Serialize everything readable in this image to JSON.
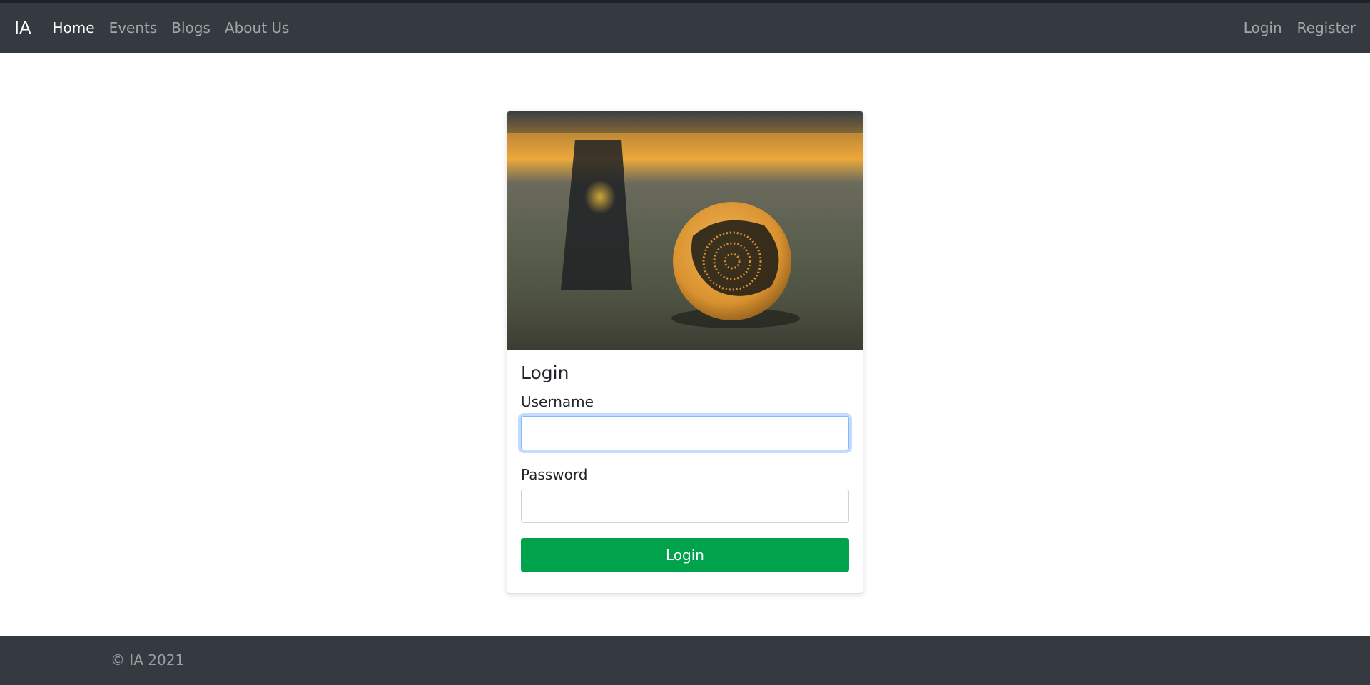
{
  "navbar": {
    "brand": "IA",
    "links": [
      {
        "label": "Home",
        "active": true
      },
      {
        "label": "Events",
        "active": false
      },
      {
        "label": "Blogs",
        "active": false
      },
      {
        "label": "About Us",
        "active": false
      }
    ],
    "right_links": [
      {
        "label": "Login"
      },
      {
        "label": "Register"
      }
    ]
  },
  "card": {
    "image_icon": "soccer-ball-photo",
    "title": "Login",
    "username": {
      "label": "Username",
      "value": "",
      "placeholder": ""
    },
    "password": {
      "label": "Password",
      "value": "",
      "placeholder": ""
    },
    "submit_label": "Login"
  },
  "footer": {
    "text": "© IA 2021"
  },
  "colors": {
    "navbar_bg": "#343a40",
    "button_bg": "#00a34b",
    "focus_border": "#86b7fe"
  }
}
